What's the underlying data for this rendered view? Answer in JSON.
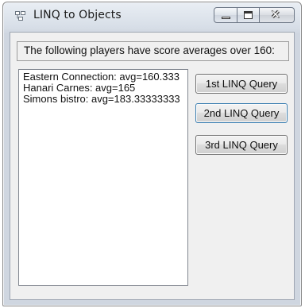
{
  "window": {
    "title": "LINQ to Objects"
  },
  "header": {
    "label": "The following players have score averages over 160:"
  },
  "results": {
    "items": [
      "Eastern Connection: avg=160.333",
      "Hanari Carnes: avg=165",
      "Simons bistro: avg=183.33333333"
    ]
  },
  "buttons": {
    "query1": "1st LINQ Query",
    "query2": "2nd LINQ Query",
    "query3": "3rd LINQ Query"
  },
  "icons": {
    "app": "window-app-icon",
    "minimize": "minimize-icon",
    "maximize": "maximize-icon",
    "close": "close-icon"
  },
  "colors": {
    "focus_border": "#3c7fb1",
    "client_background": "#f0f0f0"
  }
}
